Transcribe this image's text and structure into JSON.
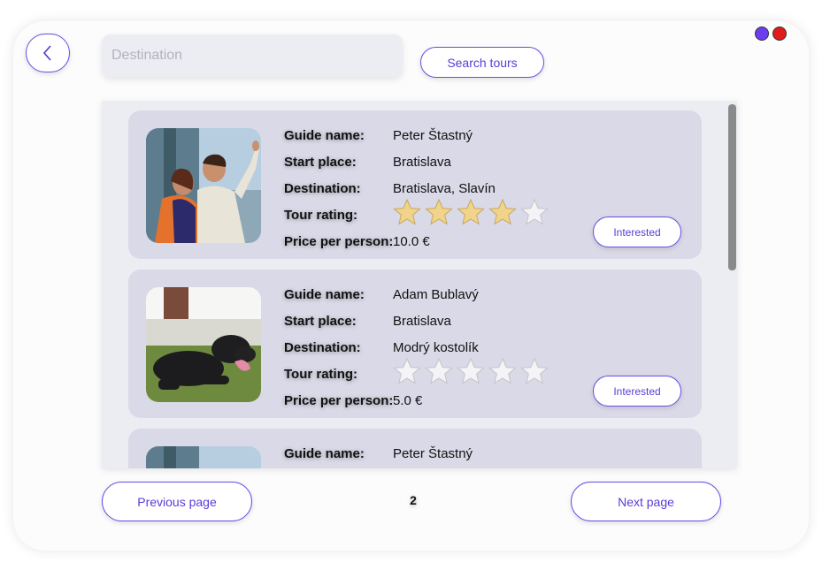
{
  "header": {
    "search": {
      "placeholder": "Destination",
      "value": ""
    },
    "search_button_label": "Search tours",
    "back_icon": "chevron-left-icon",
    "window_dots": [
      {
        "color": "#6b3cf0"
      },
      {
        "color": "#e01b1b"
      }
    ]
  },
  "tours": [
    {
      "labels": {
        "guide": "Guide name:",
        "start": "Start place:",
        "destination": "Destination:",
        "rating": "Tour rating:",
        "price": "Price per person:"
      },
      "guide_name": "Peter Štastný",
      "start_place": "Bratislava",
      "destination": "Bratislava, Slavín",
      "rating": 4,
      "rating_max": 5,
      "price": "10.0 €",
      "button_label": "Interested",
      "photo": "couple-pointing-photo"
    },
    {
      "labels": {
        "guide": "Guide name:",
        "start": "Start place:",
        "destination": "Destination:",
        "rating": "Tour rating:",
        "price": "Price per person:"
      },
      "guide_name": "Adam Bublavý",
      "start_place": "Bratislava",
      "destination": "Modrý kostolík",
      "rating": 0,
      "rating_max": 5,
      "price": "5.0 €",
      "button_label": "Interested",
      "photo": "black-dog-photo"
    },
    {
      "labels": {
        "guide": "Guide name:"
      },
      "guide_name": "Peter Štastný",
      "photo": "couple-pointing-photo"
    }
  ],
  "pagination": {
    "previous_label": "Previous page",
    "next_label": "Next page",
    "current_page": "2"
  },
  "colors": {
    "accent": "#6b4de6",
    "card": "#d9d9e7",
    "star_filled": "#f1d38b",
    "star_empty": "#f4f4f6"
  }
}
